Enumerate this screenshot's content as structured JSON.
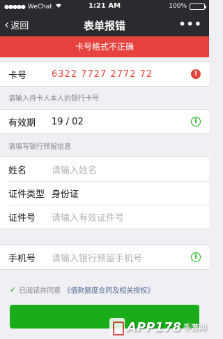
{
  "status_bar": {
    "signal": "●●●●●",
    "carrier": "WeChat",
    "time": "1:21 AM",
    "battery": "100%",
    "battery_level": 1.0
  },
  "nav": {
    "back_label": "返回",
    "title": "表单报错",
    "more": "•••"
  },
  "error_banner": "卡号格式不正确",
  "card": {
    "label": "卡号",
    "value": "6322 7727 2772 72",
    "warn_icon": "!"
  },
  "hint1": "请输入持卡人本人的银行卡号",
  "expiry": {
    "label": "有效期",
    "value": "19 / 02",
    "info_icon": "i"
  },
  "hint2": "请填写银行预留信息",
  "identity": {
    "name_label": "姓名",
    "name_placeholder": "请输入姓名",
    "id_type_label": "证件类型",
    "id_type_value": "身份证",
    "id_no_label": "证件号",
    "id_no_placeholder": "请输入有效证件号"
  },
  "phone": {
    "label": "手机号",
    "placeholder": "请输入银行预留手机号",
    "info_icon": "i"
  },
  "agreement": {
    "check": "✓",
    "prefix": "已阅读并同意",
    "link": "《借款额度合同及相关授权》"
  },
  "colors": {
    "nav_bg": "#2b2b2f",
    "error": "#e64340",
    "primary": "#1aad19",
    "link": "#576b95"
  },
  "watermark": {
    "logo": "APP178",
    "sub": "手游网"
  }
}
